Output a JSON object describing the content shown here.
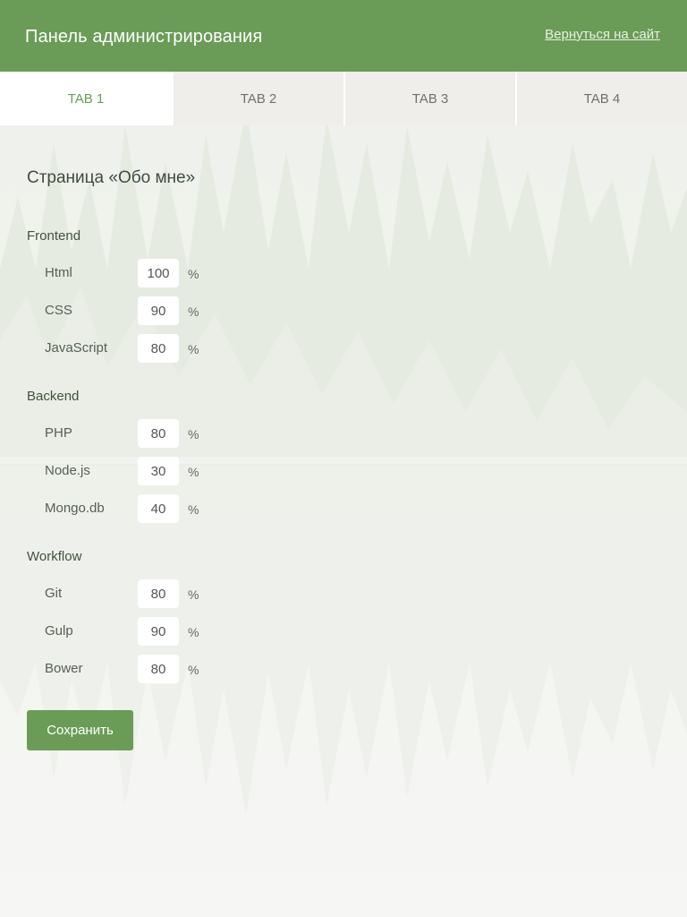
{
  "header": {
    "title": "Панель администрирования",
    "back_link": "Вернуться на сайт"
  },
  "tabs": [
    {
      "label": "TAB 1",
      "active": true
    },
    {
      "label": "TAB 2",
      "active": false
    },
    {
      "label": "TAB 3",
      "active": false
    },
    {
      "label": "TAB 4",
      "active": false
    }
  ],
  "page": {
    "title": "Страница «Обо мне»",
    "unit": "%",
    "groups": [
      {
        "title": "Frontend",
        "skills": [
          {
            "name": "Html",
            "value": "100"
          },
          {
            "name": "CSS",
            "value": "90"
          },
          {
            "name": "JavaScript",
            "value": "80"
          }
        ]
      },
      {
        "title": "Backend",
        "skills": [
          {
            "name": "PHP",
            "value": "80"
          },
          {
            "name": "Node.js",
            "value": "30"
          },
          {
            "name": "Mongo.db",
            "value": "40"
          }
        ]
      },
      {
        "title": "Workflow",
        "skills": [
          {
            "name": "Git",
            "value": "80"
          },
          {
            "name": "Gulp",
            "value": "90"
          },
          {
            "name": "Bower",
            "value": "80"
          }
        ]
      }
    ],
    "save_label": "Сохранить"
  },
  "colors": {
    "accent": "#6a9c57",
    "tab_inactive_bg": "#efeeea",
    "tab_active_text": "#6a9c57"
  }
}
